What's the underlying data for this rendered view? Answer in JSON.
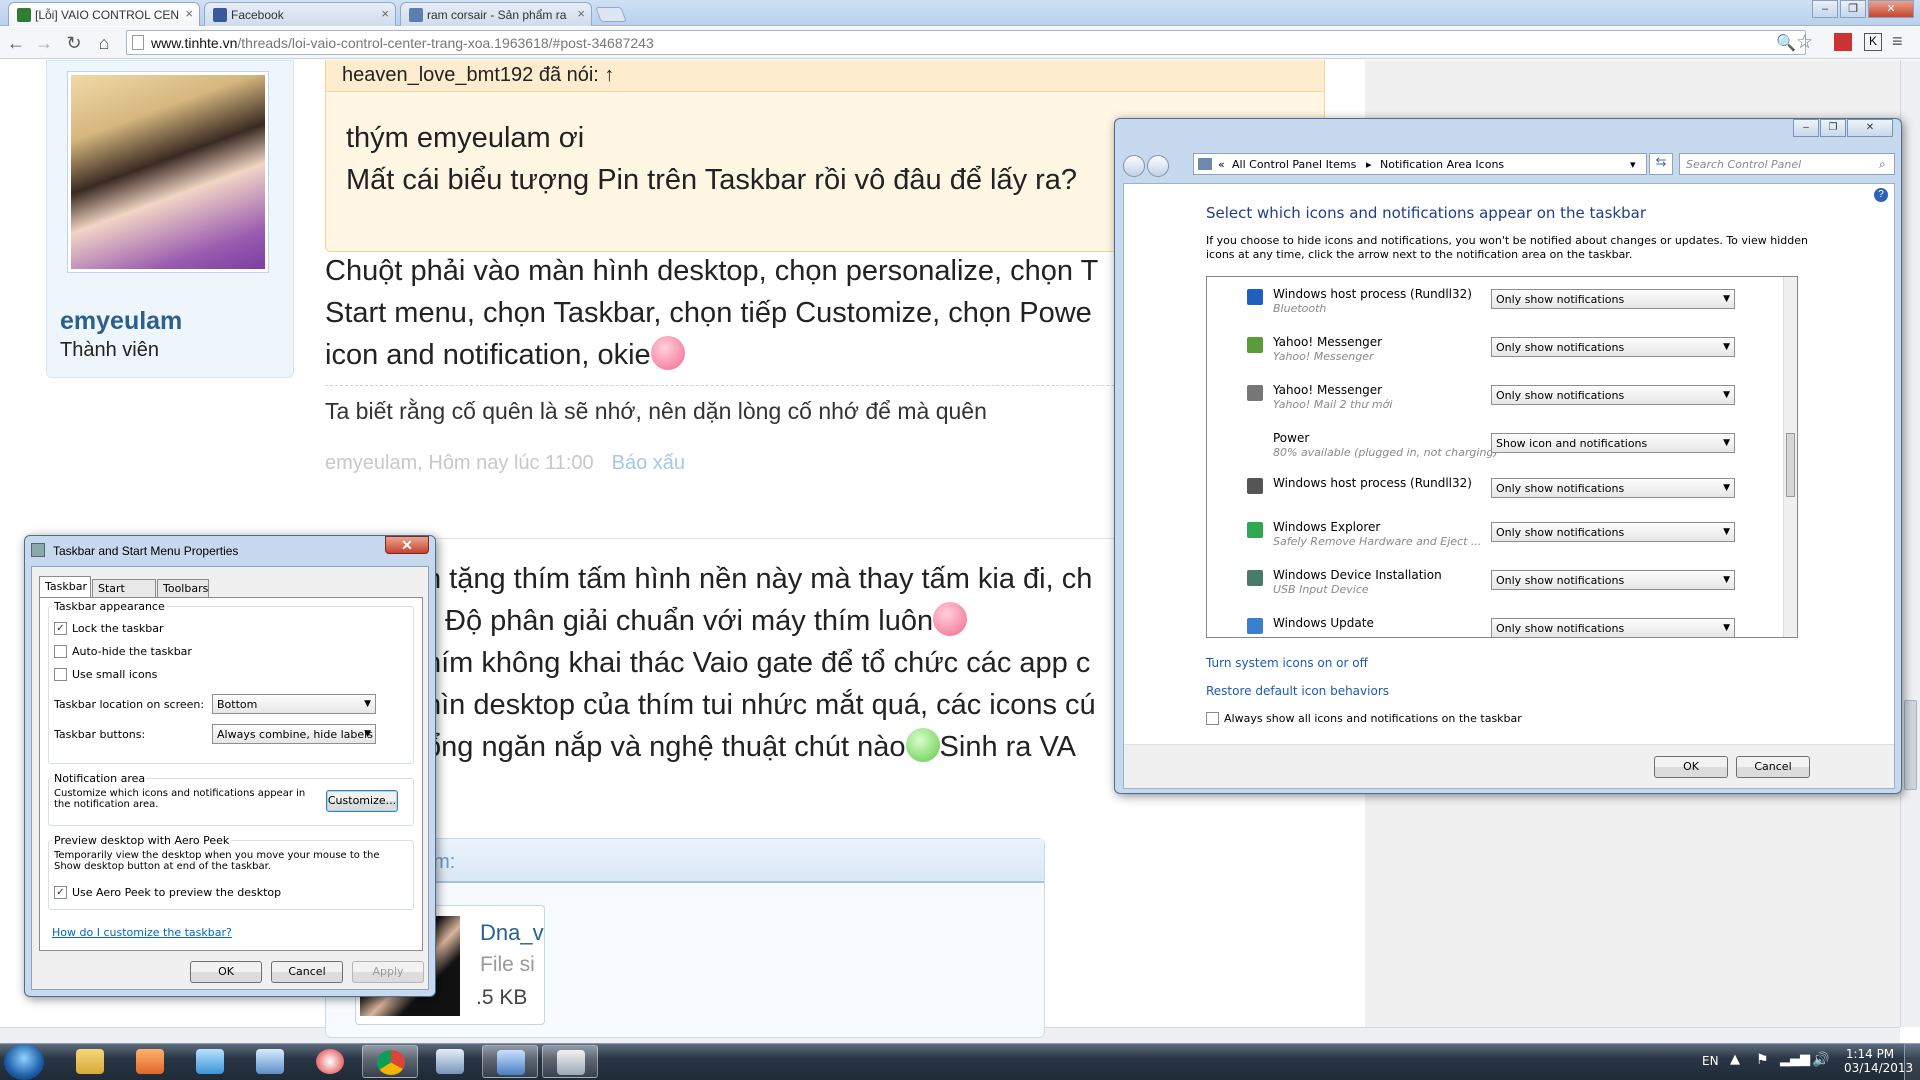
{
  "browser": {
    "tabs": [
      {
        "label": "[Lỗi] VAIO CONTROL CEN",
        "color": "#2e7d32"
      },
      {
        "label": "Facebook",
        "color": "#3b5998"
      },
      {
        "label": "ram corsair - Sản phẩm ra",
        "color": "#5a7fb0"
      }
    ],
    "url_host": "www.tinhte.vn",
    "url_path": "/threads/loi-vaio-control-center-trang-xoa.1963618/#post-34687243"
  },
  "forum": {
    "user": {
      "name": "emyeulam",
      "role": "Thành viên"
    },
    "quote": {
      "author": "heaven_love_bmt192 đã nói: ↑",
      "line1": "thým emyeulam ơi",
      "line2": "Mất cái biểu tượng Pin trên Taskbar rồi vô đâu để lấy ra?"
    },
    "post": {
      "line1": "Chuột phải vào màn hình desktop, chọn personalize, chọn T",
      "line2": "Start menu, chọn Taskbar, chọn tiếp Customize, chọn Powe",
      "line3": "icon and notification, okie"
    },
    "signature": "Ta biết rằng cố quên là sẽ nhớ, nên dặn lòng cố nhớ để mà quên",
    "meta": {
      "author": "emyeulam, Hôm nay lúc 11:00",
      "report": "Báo xấu"
    },
    "post2": {
      "line1": "n tặng thím tấm hình nền này mà thay tấm kia đi, ch",
      "line2": "Độ phân giải chuẩn với máy thím luôn",
      "line3": "hím không khai thác Vaio gate để tổ chức các app c",
      "line4": "hìn desktop của thím tui nhức mắt quá, các icons cú",
      "line5": "ổng ngăn nắp và nghệ thuật chút nào",
      "line5b": "Sinh ra VA"
    },
    "attachments": {
      "header": "ệm:",
      "name": "Dna_v",
      "size_label": "File si",
      "size": ".5 KB"
    }
  },
  "taskbar_dialog": {
    "title": "Taskbar and Start Menu Properties",
    "tabs": [
      "Taskbar",
      "Start Menu",
      "Toolbars"
    ],
    "appearance_label": "Taskbar appearance",
    "lock": "Lock the taskbar",
    "autohide": "Auto-hide the taskbar",
    "small_icons": "Use small icons",
    "location_label": "Taskbar location on screen:",
    "location_value": "Bottom",
    "buttons_label": "Taskbar buttons:",
    "buttons_value": "Always combine, hide labels",
    "notif_label": "Notification area",
    "notif_text": "Customize which icons and notifications appear in the notification area.",
    "customize": "Customize...",
    "peek_label": "Preview desktop with Aero Peek",
    "peek_text": "Temporarily view the desktop when you move your mouse to the Show desktop button at end of the taskbar.",
    "peek_check": "Use Aero Peek to preview the desktop",
    "help_link": "How do I customize the taskbar?",
    "ok": "OK",
    "cancel": "Cancel",
    "apply": "Apply"
  },
  "control_panel": {
    "crumb1": "All Control Panel Items",
    "crumb2": "Notification Area Icons",
    "search_placeholder": "Search Control Panel",
    "heading": "Select which icons and notifications appear on the taskbar",
    "intro": "If you choose to hide icons and notifications, you won't be notified about changes or updates. To view hidden icons at any time, click the arrow next to the notification area on the taskbar.",
    "rows": [
      {
        "name": "Windows host process (Rundll32)",
        "sub": "Bluetooth",
        "value": "Only show notifications",
        "color": "#1f5fbf"
      },
      {
        "name": "Yahoo! Messenger",
        "sub": "Yahoo! Messenger",
        "value": "Only show notifications",
        "color": "#5a9c3a"
      },
      {
        "name": "Yahoo! Messenger",
        "sub": "Yahoo! Mail 2 thư mới",
        "value": "Only show notifications",
        "color": "#777777"
      },
      {
        "name": "Power",
        "sub": "80% available (plugged in, not charging)",
        "value": "Show icon and notifications",
        "color": ""
      },
      {
        "name": "Windows host process (Rundll32)",
        "sub": "",
        "value": "Only show notifications",
        "color": "#555555"
      },
      {
        "name": "Windows Explorer",
        "sub": "Safely Remove Hardware and Eject ...",
        "value": "Only show notifications",
        "color": "#2fa84f"
      },
      {
        "name": "Windows Device Installation",
        "sub": "USB Input Device",
        "value": "Only show notifications",
        "color": "#4a7a6a"
      },
      {
        "name": "Windows Update",
        "sub": "",
        "value": "Only show notifications",
        "color": "#3b7fd1"
      }
    ],
    "link_system": "Turn system icons on or off",
    "link_restore": "Restore default icon behaviors",
    "always_show": "Always show all icons and notifications on the taskbar",
    "ok": "OK",
    "cancel": "Cancel"
  },
  "tray": {
    "lang": "EN",
    "time": "1:14 PM",
    "date": "03/14/2013"
  }
}
